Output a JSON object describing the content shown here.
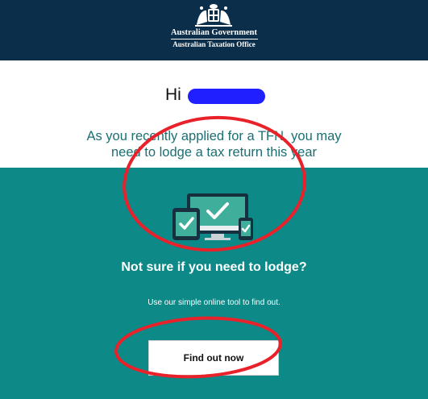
{
  "header": {
    "line1": "Australian Government",
    "line2": "Australian Taxation Office",
    "background": "#0b2e4a"
  },
  "greeting": {
    "salutation": "Hi"
  },
  "headline": {
    "line1": "As you recently applied for a TFN, you may",
    "line2": "need to lodge a tax return this year"
  },
  "promo": {
    "heading": "Not sure if you need to lodge?",
    "subtext": "Use our simple online tool to find out.",
    "cta_label": "Find out now",
    "background": "#0d8a87"
  },
  "annotation": {
    "color": "#e8212a"
  }
}
